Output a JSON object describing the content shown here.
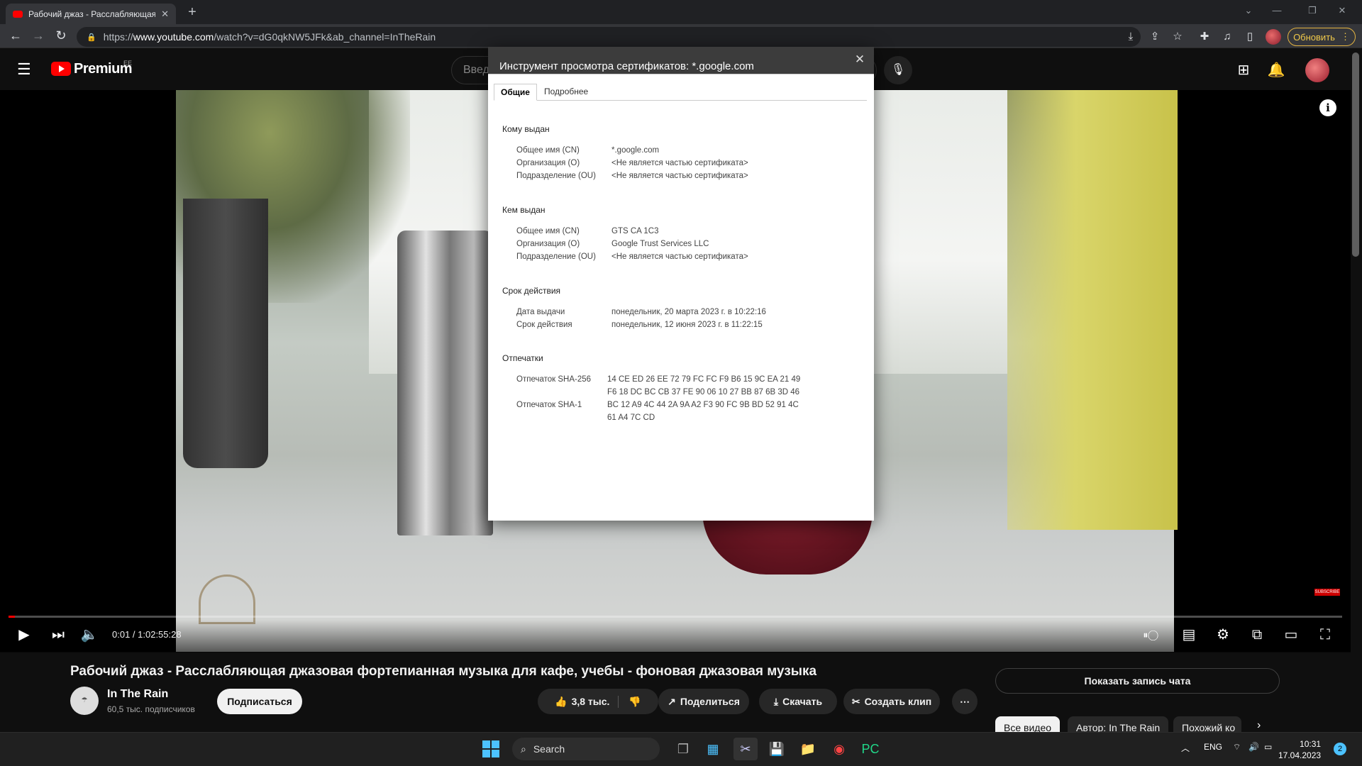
{
  "browser": {
    "tab_title": "Рабочий джаз - Расслабляющая",
    "url_prefix": "https://",
    "url_host": "www.youtube.com",
    "url_rest": "/watch?v=dG0qkNW5JFk&ab_channel=InTheRain",
    "update_label": "Обновить"
  },
  "youtube": {
    "logo_text": "Premium",
    "region": "EE",
    "search_placeholder": "Введ"
  },
  "player": {
    "time": "0:01 / 1:02:55:28",
    "progress_fraction": 0.005,
    "subscribe_watermark": "SUBSCRIBE"
  },
  "video": {
    "title": "Рабочий джаз - Расслабляющая джазовая фортепианная музыка для кафе, учебы - фоновая джазовая музыка",
    "channel_name": "In The Rain",
    "channel_subs": "60,5 тыс. подписчиков",
    "subscribe_label": "Подписаться",
    "likes": "3,8 тыс.",
    "share_label": "Поделиться",
    "download_label": "Скачать",
    "clip_label": "Создать клип",
    "chat_label": "Показать запись чата",
    "chips": [
      "Все видео",
      "Автор: In The Rain",
      "Похожий ко"
    ]
  },
  "dialog": {
    "title": "Инструмент просмотра сертификатов: *.google.com",
    "tabs": [
      "Общие",
      "Подробнее"
    ],
    "sections": {
      "issued_to": {
        "heading": "Кому выдан",
        "rows": [
          {
            "label": "Общее имя (CN)",
            "value": "*.google.com"
          },
          {
            "label": "Организация (O)",
            "value": "<Не является частью сертификата>"
          },
          {
            "label": "Подразделение (OU)",
            "value": "<Не является частью сертификата>"
          }
        ]
      },
      "issued_by": {
        "heading": "Кем выдан",
        "rows": [
          {
            "label": "Общее имя (CN)",
            "value": "GTS CA 1C3"
          },
          {
            "label": "Организация (O)",
            "value": "Google Trust Services LLC"
          },
          {
            "label": "Подразделение (OU)",
            "value": "<Не является частью сертификата>"
          }
        ]
      },
      "validity": {
        "heading": "Срок действия",
        "rows": [
          {
            "label": "Дата выдачи",
            "value": "понедельник, 20 марта 2023 г. в 10:22:16"
          },
          {
            "label": "Срок действия",
            "value": "понедельник, 12 июня 2023 г. в 11:22:15"
          }
        ]
      },
      "fingerprints": {
        "heading": "Отпечатки",
        "rows": [
          {
            "label": "Отпечаток SHA-256",
            "value_line1": "14 CE ED 26 EE 72 79 FC FC F9 B6 15 9C EA 21 49",
            "value_line2": "F6 18 DC BC CB 37 FE 90 06 10 27 BB 87 6B 3D 46"
          },
          {
            "label": "Отпечаток SHA-1",
            "value_line1": "BC 12 A9 4C 44 2A 9A A2 F3 90 FC 9B BD 52 91 4C",
            "value_line2": "61 A4 7C CD"
          }
        ]
      }
    }
  },
  "taskbar": {
    "search_label": "Search",
    "lang": "ENG",
    "time": "10:31",
    "date": "17.04.2023",
    "notifications": "2"
  }
}
